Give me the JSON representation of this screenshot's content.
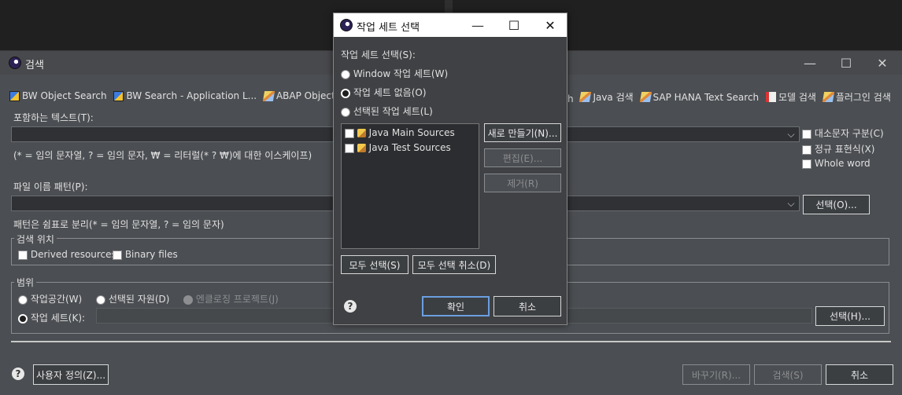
{
  "main_window": {
    "title": "검색",
    "tabs": [
      {
        "label": "BW Object Search",
        "icon": "bw-icon"
      },
      {
        "label": "BW Search - Application L...",
        "icon": "bw-icon"
      },
      {
        "label": "ABAP Object Sea",
        "icon": "pen-icon"
      },
      {
        "label": "h",
        "icon": ""
      },
      {
        "label": "Java 검색",
        "icon": "pen-icon"
      },
      {
        "label": "SAP HANA Text Search",
        "icon": "pen-icon"
      },
      {
        "label": "모델 검색",
        "icon": "model-icon"
      },
      {
        "label": "플러그인 검색",
        "icon": "pen-icon"
      }
    ],
    "contains_text_label": "포함하는 텍스트(T):",
    "contains_text_value": "",
    "text_hint": "(* = 임의 문자열, ? = 임의 문자, ₩ = 리터럴(* ? ₩)에 대한 이스케이프)",
    "case_sensitive_label": "대소문자 구분(C)",
    "regex_label": "정규 표현식(X)",
    "whole_word_label": "Whole word",
    "file_pattern_label": "파일 이름 패턴(P):",
    "file_pattern_value": "",
    "select_button": "선택(O)...",
    "pattern_hint": "패턴은 쉼표로 분리(* = 임의 문자열, ? = 임의 문자)",
    "search_in": {
      "legend": "검색 위치",
      "derived_resources": "Derived resources",
      "binary_files": "Binary files"
    },
    "scope": {
      "legend": "범위",
      "workspace": "작업공간(W)",
      "selected_resources": "선택된 자원(D)",
      "enclosing_projects": "엔클로징 프로젝트(J)",
      "working_set": "작업 세트(K):",
      "working_set_value": "",
      "choose_button": "선택(H)..."
    },
    "customize_button": "사용자 정의(Z)...",
    "replace_button": "바꾸기(R)...",
    "search_button": "검색(S)",
    "cancel_button": "취소"
  },
  "dialog": {
    "title": "작업 세트 선택",
    "prompt": "작업 세트 선택(S):",
    "options": [
      "Window 작업 세트(W)",
      "작업 세트 없음(O)",
      "선택된 작업 세트(L)"
    ],
    "selected_option": "작업 세트 없음(O)",
    "list_items": [
      "Java Main Sources",
      "Java Test Sources"
    ],
    "new_button": "새로 만들기(N)...",
    "edit_button": "편집(E)...",
    "remove_button": "제거(R)",
    "select_all_button": "모두 선택(S)",
    "deselect_all_button": "모두 선택 취소(D)",
    "ok_button": "확인",
    "cancel_button": "취소"
  },
  "colors": {
    "window_bg": "#4b4e52",
    "dialog_bg": "#3f4144",
    "list_bg": "#2c2d30",
    "default_button_border": "#6a9fe0"
  }
}
